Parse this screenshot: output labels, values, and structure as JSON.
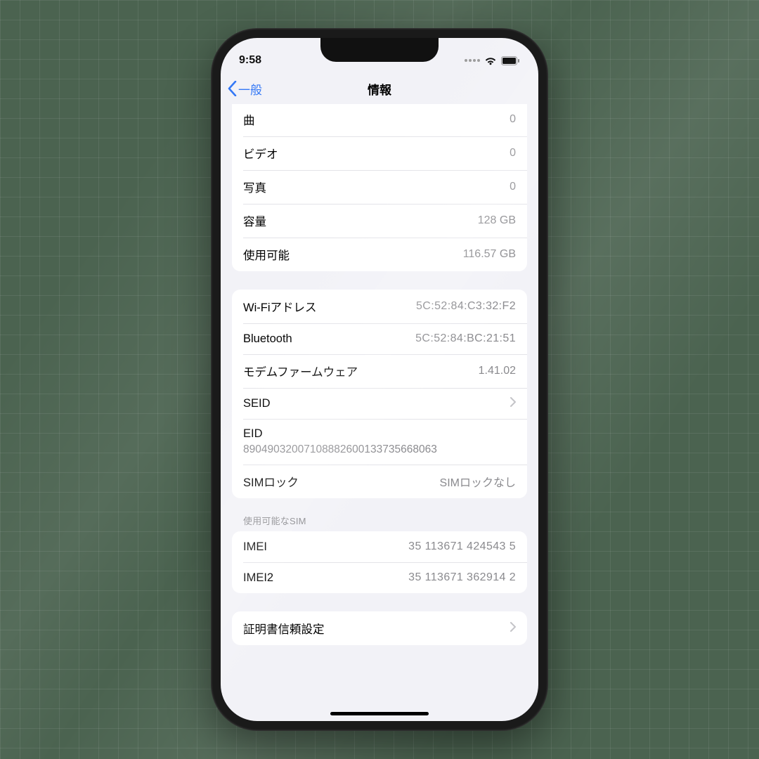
{
  "status": {
    "time": "9:58"
  },
  "nav": {
    "back": "一般",
    "title": "情報"
  },
  "group1": {
    "songs_label": "曲",
    "songs_value": "0",
    "videos_label": "ビデオ",
    "videos_value": "0",
    "photos_label": "写真",
    "photos_value": "0",
    "capacity_label": "容量",
    "capacity_value": "128 GB",
    "available_label": "使用可能",
    "available_value": "116.57 GB"
  },
  "group2": {
    "wifi_label": "Wi-Fiアドレス",
    "wifi_value": "5C:52:84:C3:32:F2",
    "bt_label": "Bluetooth",
    "bt_value": "5C:52:84:BC:21:51",
    "modem_label": "モデムファームウェア",
    "modem_value": "1.41.02",
    "seid_label": "SEID",
    "eid_label": "EID",
    "eid_value": "89049032007108882600133735668063",
    "simlock_label": "SIMロック",
    "simlock_value": "SIMロックなし"
  },
  "sim_header": "使用可能なSIM",
  "group3": {
    "imei_label": "IMEI",
    "imei_value": "35 113671 424543 5",
    "imei2_label": "IMEI2",
    "imei2_value": "35 113671 362914 2"
  },
  "group4": {
    "cert_label": "証明書信頼設定"
  }
}
